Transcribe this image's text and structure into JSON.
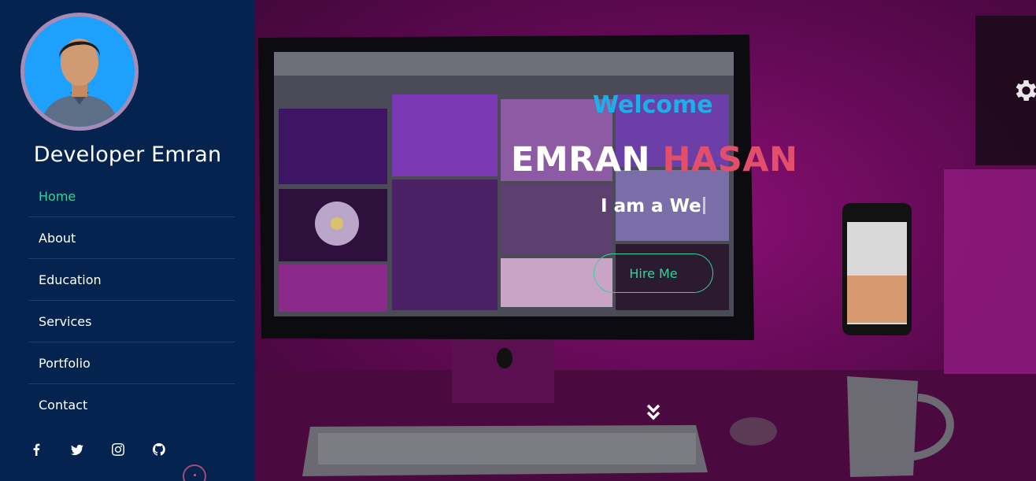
{
  "sidebar": {
    "brand": "Developer Emran",
    "nav": [
      {
        "label": "Home",
        "active": true
      },
      {
        "label": "About"
      },
      {
        "label": "Education"
      },
      {
        "label": "Services"
      },
      {
        "label": "Portfolio"
      },
      {
        "label": "Contact"
      }
    ],
    "social_icons": [
      "facebook-icon",
      "twitter-icon",
      "instagram-icon",
      "github-icon"
    ]
  },
  "hero": {
    "welcome": "Welcome",
    "first_name": "EMRAN",
    "last_name": "HASAN",
    "typed_text": "I am a We",
    "hire_button": "Hire Me"
  },
  "colors": {
    "sidebar_bg": "#04244f",
    "accent_green": "#34d39a",
    "welcome_blue": "#1cb0e8",
    "name_red": "#e14f6d",
    "hero_magenta": "#8a0f74"
  }
}
